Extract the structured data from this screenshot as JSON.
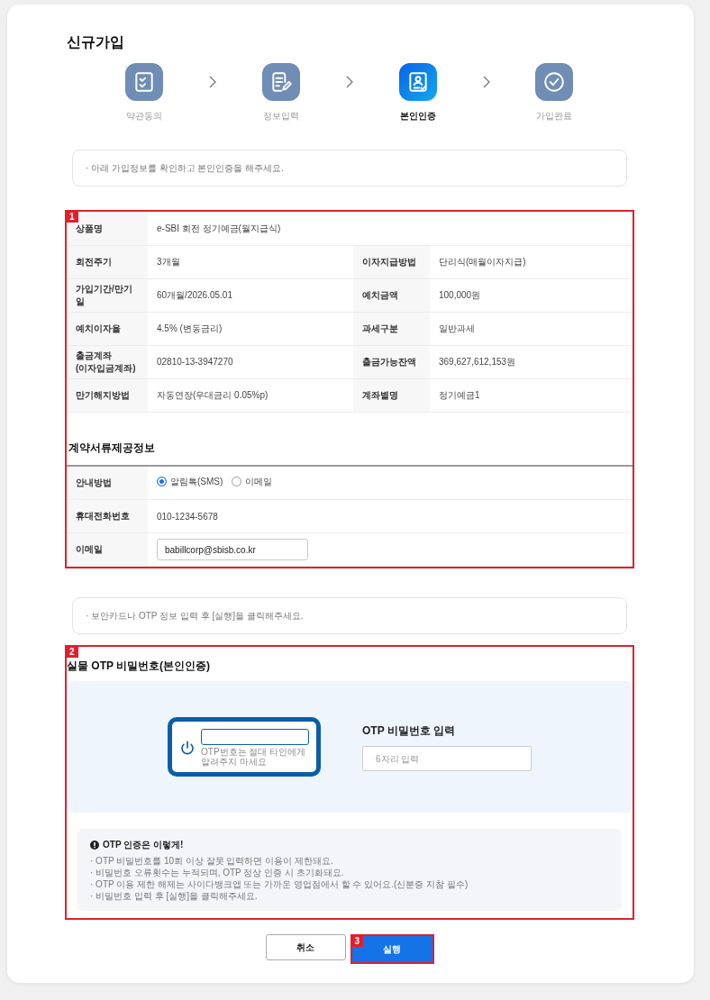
{
  "page_title": "신규가입",
  "steps": [
    {
      "label": "약관동의",
      "selected": false
    },
    {
      "label": "정보입력",
      "selected": false
    },
    {
      "label": "본인인증",
      "selected": true
    },
    {
      "label": "가입완료",
      "selected": false
    }
  ],
  "notice_1": "· 아래 가입정보를 확인하고 본인인증을 해주세요.",
  "review_section": {
    "marker": "1",
    "rows": [
      [
        {
          "label": "상품명",
          "value": "e-SBI 회전 정기예금(월지급식)"
        }
      ],
      [
        {
          "label": "회전주기",
          "value": "3개월"
        },
        {
          "label": "이자지급방법",
          "value": "단리식(매월이자지급)"
        }
      ],
      [
        {
          "label": "가입기간/만기일",
          "value": "60개월/2026.05.01"
        },
        {
          "label": "예치금액",
          "value": "100,000원"
        }
      ],
      [
        {
          "label": "예치이자율",
          "value": "4.5% (변동금리)"
        },
        {
          "label": "과세구분",
          "value": "일반과세"
        }
      ],
      [
        {
          "label": "출금계좌\n(이자입금계좌)",
          "value": "02810-13-3947270"
        },
        {
          "label": "출금가능잔액",
          "value": "369,627,612,153원"
        }
      ],
      [
        {
          "label": "만기해지방법",
          "value": "자동연장(우대금리 0.05%p)"
        },
        {
          "label": "계좌별명",
          "value": "정기예금1"
        }
      ]
    ],
    "contract_title": "계약서류제공정보",
    "notify_label": "안내방법",
    "notify_options": [
      {
        "label": "알림톡(SMS)",
        "selected": true
      },
      {
        "label": "이메일",
        "selected": false
      }
    ],
    "phone_label": "휴대전화번호",
    "phone": "010-1234-5678",
    "email_label": "이메일",
    "email": "babillcorp@sbisb.co.kr"
  },
  "notice_2": "· 보안카드나 OTP 정보 입력 후 [실행]을 클릭해주세요.",
  "otp_section": {
    "marker": "2",
    "title": "실물 OTP 비밀번호(본인인증)",
    "device_note": "OTP번호는 절대 타인에게 알려주지 마세요",
    "input_label": "OTP 비밀번호 입력",
    "placeholder": "6자리 입력",
    "guide_title": "OTP 인증은 이렇게!",
    "guide_items": [
      "· OTP 비밀번호를 10회 이상 잘못 입력하면 이용이 제한돼요.",
      "· 비밀번호 오류횟수는 누적되며, OTP 정상 인증 시 초기화돼요.",
      "· OTP 이용 제한 해제는 사이다뱅크앱 또는 가까운 영업점에서 할 수 있어요.(신분증 지참 필수)",
      "· 비밀번호 입력 후 [실행]을 클릭해주세요."
    ]
  },
  "buttons": [
    {
      "label": "취소",
      "kind": "secondary"
    },
    {
      "label": "실행",
      "kind": "primary",
      "marker": "3"
    }
  ]
}
